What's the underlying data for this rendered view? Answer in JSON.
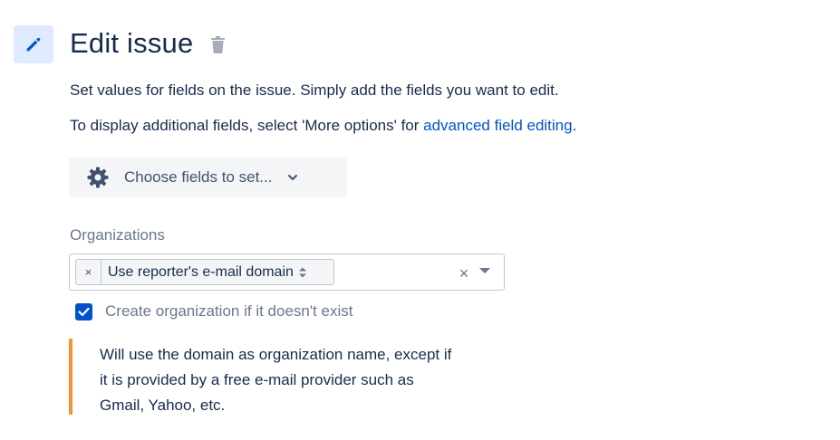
{
  "header": {
    "title": "Edit issue",
    "icon": "pencil-icon",
    "delete_icon": "trash-icon"
  },
  "description": {
    "line1": "Set values for fields on the issue. Simply add the fields you want to edit.",
    "line2_prefix": "To display additional fields, select 'More options' for ",
    "line2_link": "advanced field editing",
    "line2_suffix": "."
  },
  "choose_fields": {
    "label": "Choose fields to set...",
    "icon": "gear-icon",
    "chevron": "chevron-down-icon"
  },
  "organizations": {
    "label": "Organizations",
    "selected_chip": "Use reporter's e-mail domain",
    "chip_remove": "×",
    "clear": "×"
  },
  "create_org": {
    "label": "Create organization if it doesn't exist",
    "checked": true
  },
  "note": {
    "line1": "Will use the domain as organization name, except if",
    "line2": "it is provided by a free e-mail provider such as",
    "line3": "Gmail, Yahoo, etc."
  },
  "colors": {
    "accent": "#0052cc",
    "icon_bg": "#deebff",
    "warning_bar": "#f79232",
    "text": "#172b4d",
    "muted": "#6b778c"
  }
}
